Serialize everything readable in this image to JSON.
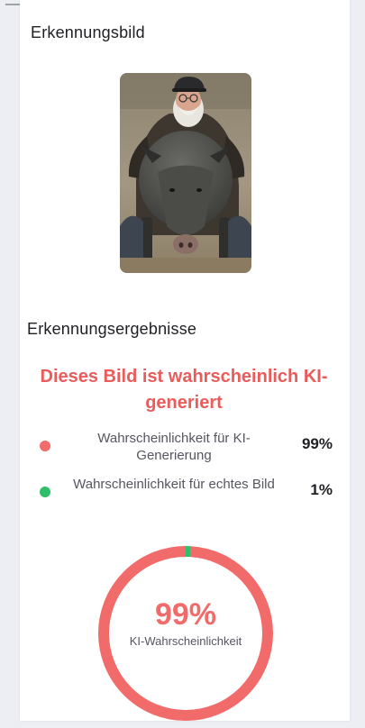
{
  "sections": {
    "image_title": "Erkennungsbild",
    "results_title": "Erkennungsergebnisse"
  },
  "verdict": {
    "text": "Dieses Bild ist wahrscheinlich KI-generiert",
    "color": "#ea5b5b"
  },
  "results": [
    {
      "label": "Wahrscheinlichkeit für KI-Generierung",
      "value": "99%",
      "dot_color": "#f26b6b"
    },
    {
      "label": "Wahrscheinlichkeit für echtes Bild",
      "value": "1%",
      "dot_color": "#2fbe6a"
    }
  ],
  "gauge": {
    "percent_text": "99%",
    "caption": "KI-Wahrscheinlichkeit",
    "ai_fraction": 0.99,
    "real_fraction": 0.01,
    "ai_color": "#f26b6b",
    "real_color": "#2fbe6a"
  },
  "icons": {
    "photo": "photo-man-with-wild-boar"
  }
}
